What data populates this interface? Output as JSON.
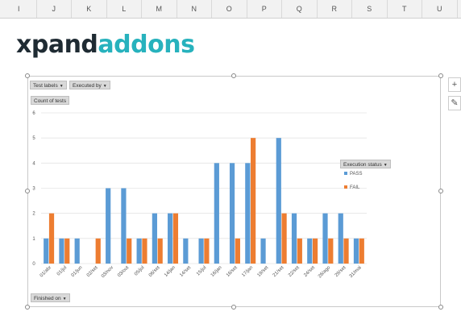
{
  "spreadsheet": {
    "columns": [
      "I",
      "J",
      "K",
      "L",
      "M",
      "N",
      "O",
      "P",
      "Q",
      "R",
      "S",
      "T",
      "U"
    ]
  },
  "logo": {
    "part1": "xpand",
    "part2": "addons"
  },
  "pivot_buttons": {
    "row_field_1": "Test labels",
    "row_field_2": "Executed by",
    "value_field": "Count of tests",
    "axis_field": "Finished on",
    "legend_field": "Execution status"
  },
  "colors": {
    "pass": "#5b9bd5",
    "fail": "#ed7d31",
    "logo_dark": "#1f2b33",
    "logo_teal": "#27b2bd"
  },
  "chart_data": {
    "type": "bar",
    "categories": [
      "01/abr",
      "01/jul",
      "01/jun",
      "02/set",
      "03/nov",
      "03/out",
      "05/jul",
      "06/set",
      "14/jan",
      "14/set",
      "15/jul",
      "16/jan",
      "16/set",
      "17/jan",
      "19/set",
      "21/set",
      "22/set",
      "24/set",
      "26/ago",
      "29/set",
      "31/mai"
    ],
    "series": [
      {
        "name": "PASS",
        "values": [
          1,
          1,
          1,
          0,
          3,
          3,
          1,
          2,
          2,
          1,
          1,
          4,
          4,
          4,
          1,
          5,
          2,
          1,
          2,
          2,
          1
        ]
      },
      {
        "name": "FAIL",
        "values": [
          2,
          1,
          0,
          1,
          0,
          1,
          1,
          1,
          2,
          0,
          1,
          0,
          1,
          5,
          0,
          2,
          1,
          1,
          1,
          1,
          1
        ]
      }
    ],
    "ylim": [
      0,
      6
    ],
    "yticks": [
      0,
      1,
      2,
      3,
      4,
      5,
      6
    ],
    "grid": true,
    "legend": "right",
    "legend_title": "Execution status"
  }
}
